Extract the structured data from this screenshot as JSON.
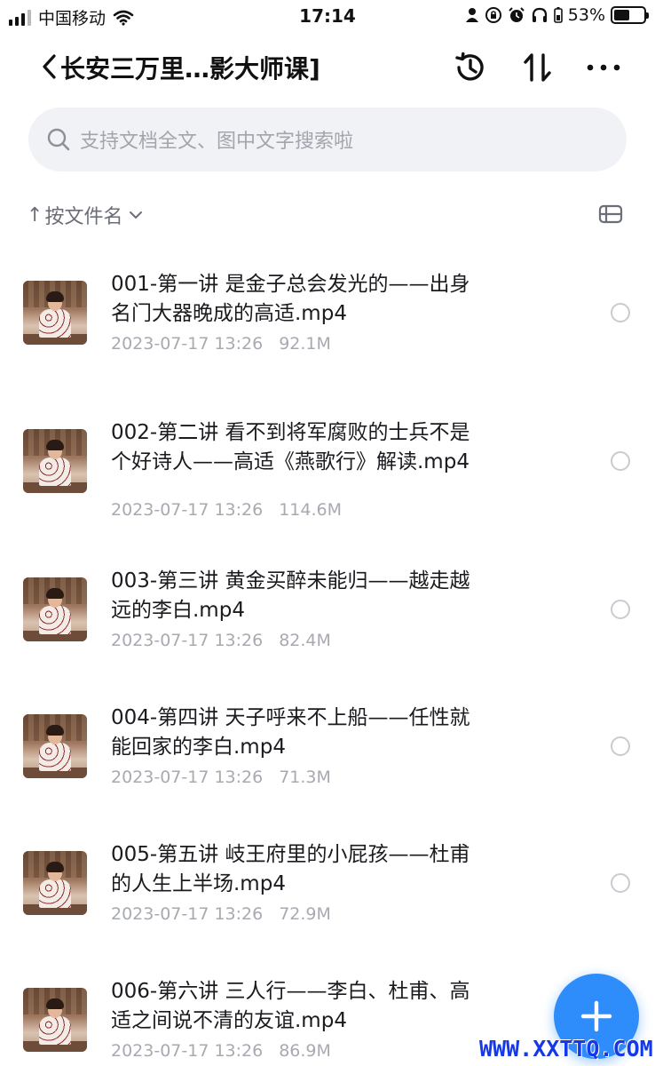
{
  "status_bar": {
    "carrier": "中国移动",
    "time": "17:14",
    "battery_percent": "53%",
    "battery_level": 0.53,
    "icons": [
      "signal-icon",
      "wifi-icon",
      "person-icon",
      "rotation-lock-icon",
      "alarm-icon",
      "headphones-icon",
      "battery-icon"
    ]
  },
  "nav": {
    "title": "长安三万里…影大师课]",
    "actions": [
      "history-icon",
      "sort-toggle-icon",
      "more-icon"
    ]
  },
  "search": {
    "placeholder": "支持文档全文、图中文字搜索啦"
  },
  "sort": {
    "arrow": "↑",
    "label": "按文件名",
    "icons": [
      "chevron-down-icon",
      "view-toggle-icon"
    ]
  },
  "files": [
    {
      "name": "001-第一讲 是金子总会发光的——出身\n名门大器晚成的高适.mp4",
      "date": "2023-07-17 13:26",
      "size": "92.1M"
    },
    {
      "name": "002-第二讲 看不到将军腐败的士兵不是\n个好诗人——高适《燕歌行》解读.mp4",
      "date": "2023-07-17 13:26",
      "size": "114.6M"
    },
    {
      "name": "003-第三讲 黄金买醉未能归——越走越\n远的李白.mp4",
      "date": "2023-07-17 13:26",
      "size": "82.4M"
    },
    {
      "name": "004-第四讲 天子呼来不上船——任性就\n能回家的李白.mp4",
      "date": "2023-07-17 13:26",
      "size": "71.3M"
    },
    {
      "name": "005-第五讲 岐王府里的小屁孩——杜甫\n的人生上半场.mp4",
      "date": "2023-07-17 13:26",
      "size": "72.9M"
    },
    {
      "name": "006-第六讲 三人行——李白、杜甫、高\n适之间说不清的友谊.mp4",
      "date": "2023-07-17 13:26",
      "size": "86.9M"
    }
  ],
  "fab": {
    "icon": "plus-icon"
  },
  "watermark": "WWW.XXTTQ.COM",
  "colors": {
    "accent": "#2f8dfb",
    "search_bg": "#f1f2f6",
    "meta_text": "#a8aab2",
    "watermark": "#1539e8"
  }
}
